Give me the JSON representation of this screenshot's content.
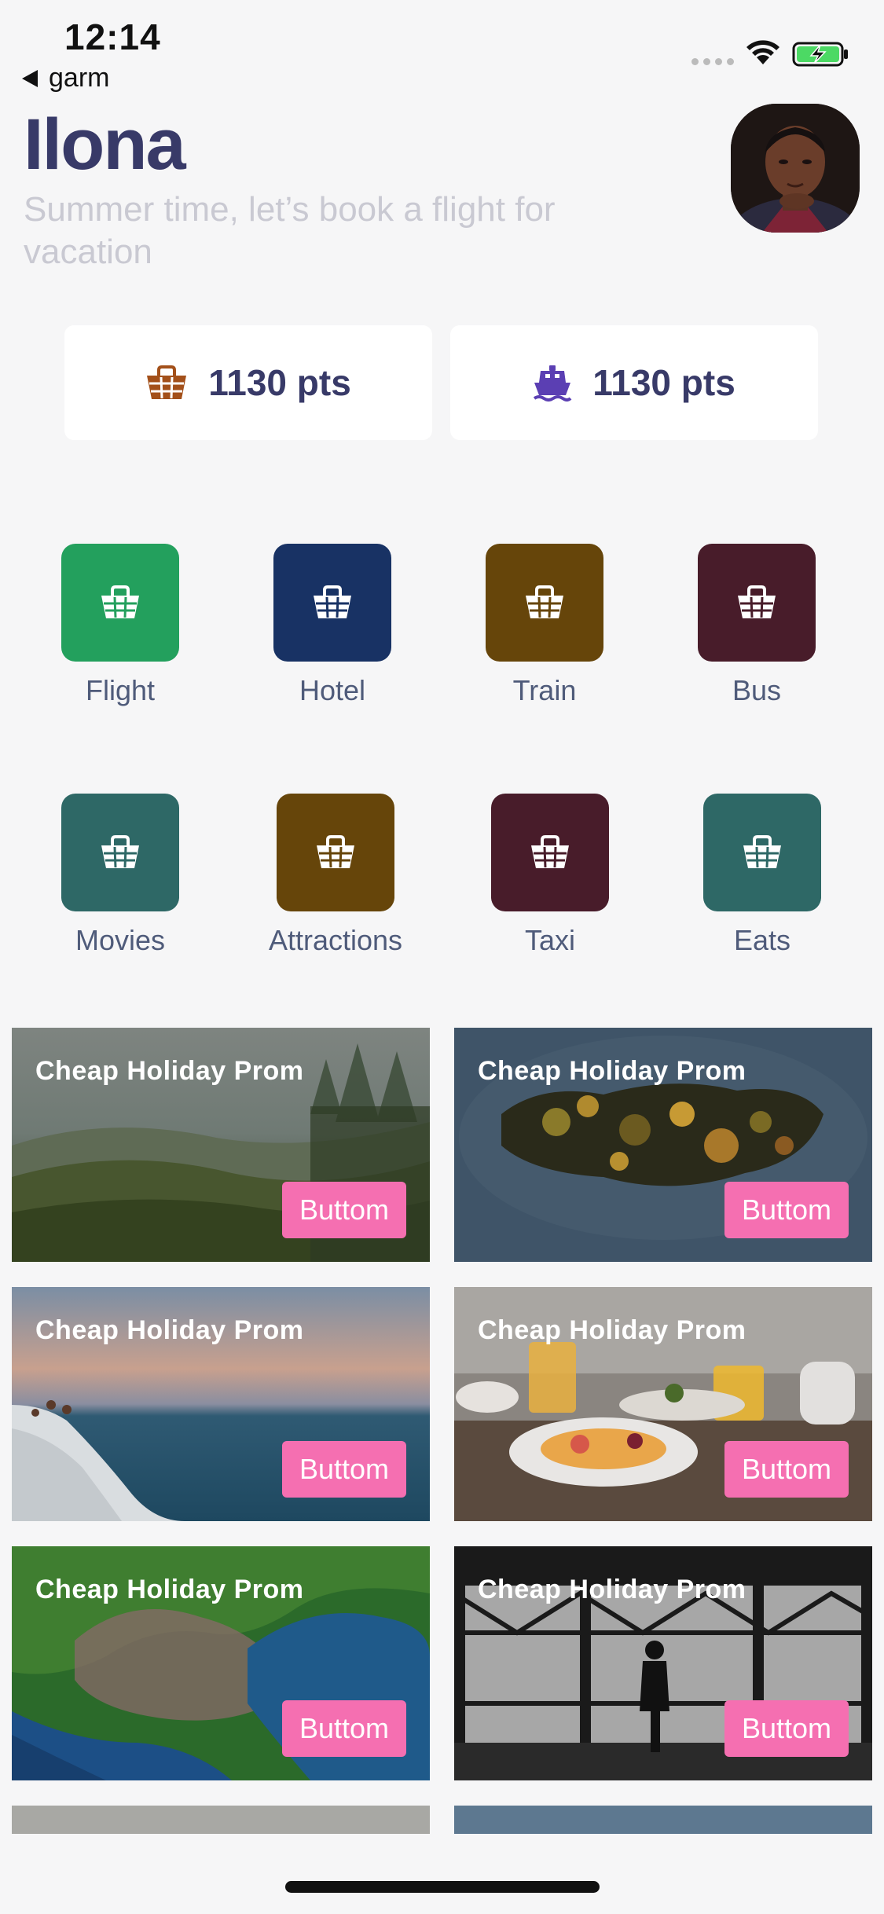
{
  "status_bar": {
    "time": "12:14",
    "back_label": "garm"
  },
  "header": {
    "title": "Ilona",
    "subtitle": "Summer time, let’s book a flight for vacation"
  },
  "points": [
    {
      "label": "1130 pts",
      "icon": "basket-icon",
      "color": "#a3501a"
    },
    {
      "label": "1130 pts",
      "icon": "ship-icon",
      "color": "#5b3fb3"
    }
  ],
  "categories": [
    {
      "label": "Flight",
      "color": "#23a05d"
    },
    {
      "label": "Hotel",
      "color": "#183264"
    },
    {
      "label": "Train",
      "color": "#66450a"
    },
    {
      "label": "Bus",
      "color": "#481c2a"
    },
    {
      "label": "Movies",
      "color": "#2e6866"
    },
    {
      "label": "Attractions",
      "color": "#66450a"
    },
    {
      "label": "Taxi",
      "color": "#481c2a"
    },
    {
      "label": "Eats",
      "color": "#2e6866"
    }
  ],
  "promos": [
    {
      "title": "Cheap Holiday Prom",
      "button": "Buttom"
    },
    {
      "title": "Cheap Holiday Prom",
      "button": "Buttom"
    },
    {
      "title": "Cheap Holiday Prom",
      "button": "Buttom"
    },
    {
      "title": "Cheap Holiday Prom",
      "button": "Buttom"
    },
    {
      "title": "Cheap Holiday Prom",
      "button": "Buttom"
    },
    {
      "title": "Cheap Holiday Prom",
      "button": "Buttom"
    }
  ],
  "colors": {
    "accent_button": "#f56fb1",
    "title_text": "#383a68",
    "background": "#f6f6f7"
  }
}
